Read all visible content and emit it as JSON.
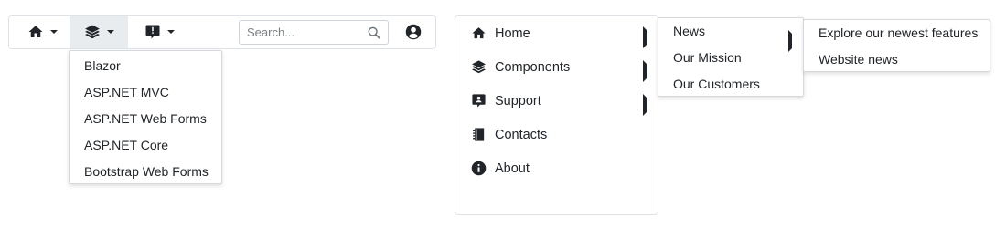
{
  "toolbar": {
    "items": [
      {
        "icon": "home-icon"
      },
      {
        "icon": "layers-icon",
        "active": true
      },
      {
        "icon": "support-chat-icon"
      }
    ],
    "search": {
      "placeholder": "Search...",
      "value": ""
    },
    "user_icon": "user-circle-icon"
  },
  "toolbar_dropdown": {
    "items": [
      "Blazor",
      "ASP.NET MVC",
      "ASP.NET Web Forms",
      "ASP.NET Core",
      "Bootstrap Web Forms"
    ]
  },
  "vertical_menu": {
    "items": [
      {
        "label": "Home",
        "icon": "home-icon",
        "has_submenu": true
      },
      {
        "label": "Components",
        "icon": "layers-icon",
        "has_submenu": true
      },
      {
        "label": "Support",
        "icon": "support-chat-icon",
        "has_submenu": true
      },
      {
        "label": "Contacts",
        "icon": "contacts-book-icon",
        "has_submenu": false
      },
      {
        "label": "About",
        "icon": "info-icon",
        "has_submenu": false
      }
    ]
  },
  "home_submenu": {
    "items": [
      {
        "label": "News",
        "has_submenu": true
      },
      {
        "label": "Our Mission",
        "has_submenu": false
      },
      {
        "label": "Our Customers",
        "has_submenu": false
      }
    ]
  },
  "news_submenu": {
    "items": [
      "Explore our newest features",
      "Website news"
    ]
  },
  "colors": {
    "text": "#212529",
    "border": "#dee2e6",
    "active_bg": "#e9ecef"
  }
}
